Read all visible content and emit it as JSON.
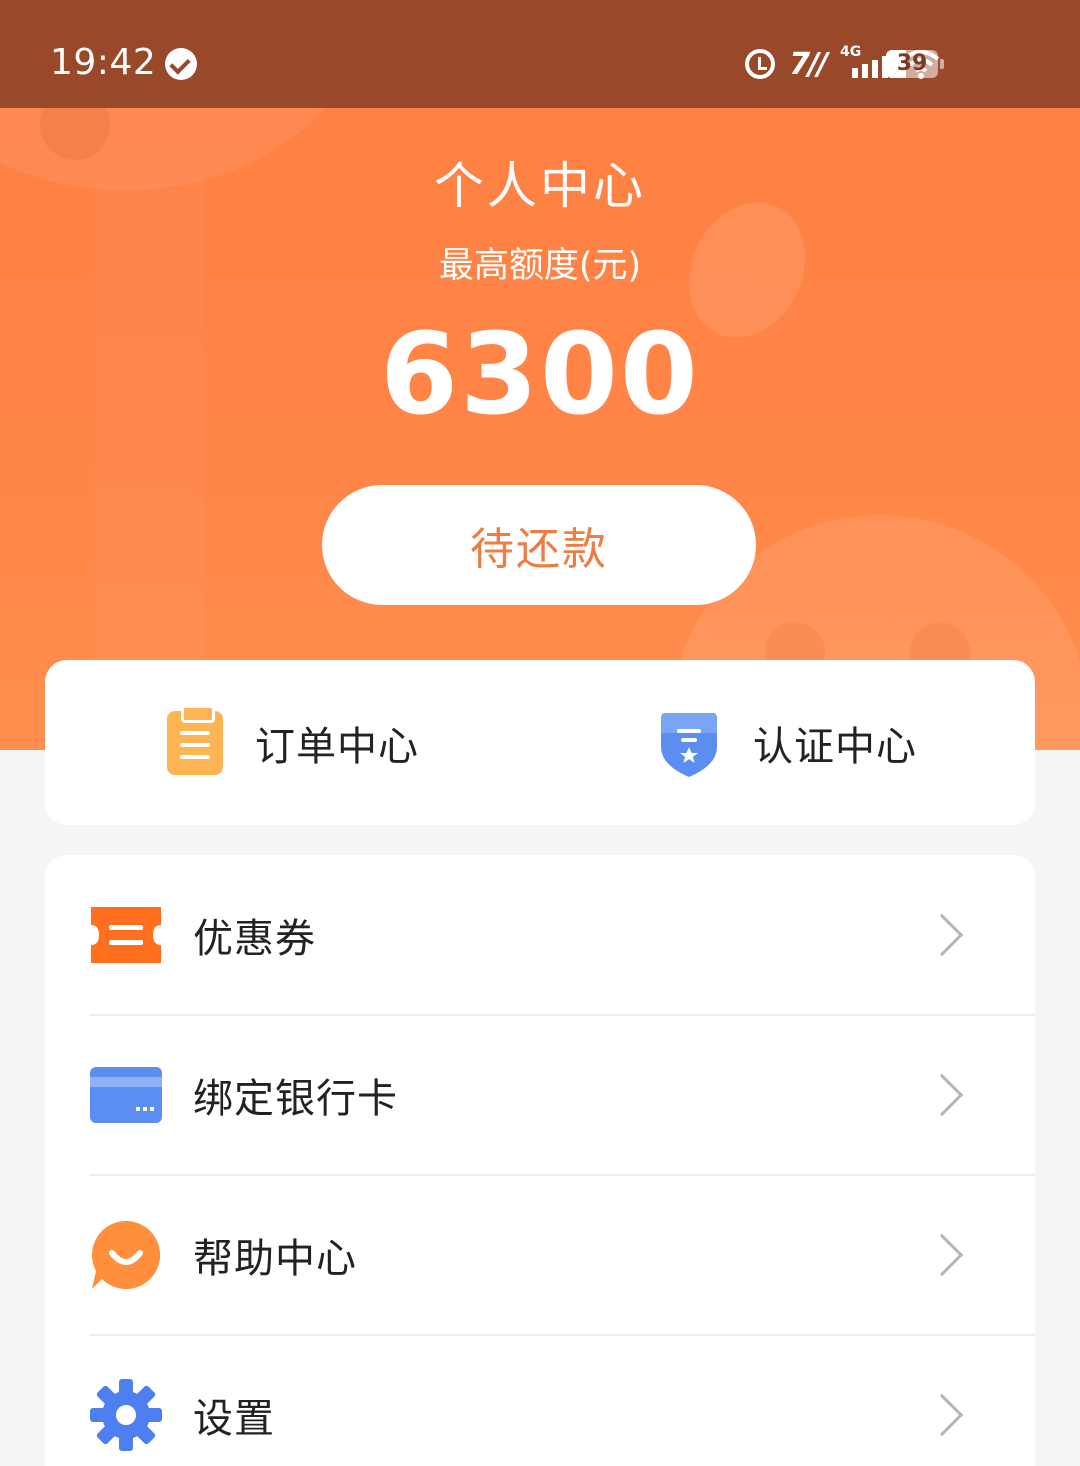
{
  "status_bar": {
    "time": "19:42",
    "network": "4G",
    "battery": "39",
    "hd": "7//"
  },
  "header": {
    "title": "个人中心",
    "limit_label": "最高额度(元)",
    "limit_amount": "6300"
  },
  "repay_button": {
    "label": "待还款"
  },
  "quick_actions": [
    {
      "label": "订单中心",
      "icon": "clipboard-icon"
    },
    {
      "label": "认证中心",
      "icon": "shield-star-icon"
    }
  ],
  "menu": [
    {
      "label": "优惠券",
      "icon": "coupon-icon"
    },
    {
      "label": "绑定银行卡",
      "icon": "bank-card-icon"
    },
    {
      "label": "帮助中心",
      "icon": "smile-chat-icon"
    },
    {
      "label": "设置",
      "icon": "gear-icon"
    }
  ],
  "colors": {
    "primary": "#ff8547",
    "status_bar": "#99492a",
    "button_text": "#f07c44",
    "blue": "#5b8ef0"
  }
}
